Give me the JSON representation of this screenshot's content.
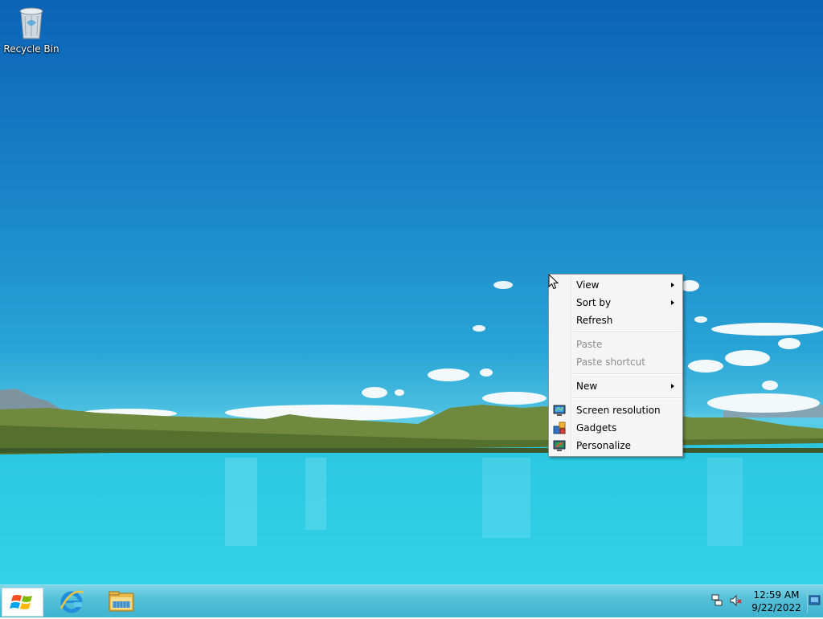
{
  "desktop": {
    "icons": [
      {
        "label": "Recycle Bin",
        "icon": "recycle-bin-icon"
      }
    ]
  },
  "context_menu": {
    "items": [
      {
        "label": "View",
        "submenu": true,
        "enabled": true
      },
      {
        "label": "Sort by",
        "submenu": true,
        "enabled": true
      },
      {
        "label": "Refresh",
        "submenu": false,
        "enabled": true
      },
      {
        "label": "Paste",
        "submenu": false,
        "enabled": false
      },
      {
        "label": "Paste shortcut",
        "submenu": false,
        "enabled": false
      },
      {
        "label": "New",
        "submenu": true,
        "enabled": true
      },
      {
        "label": "Screen resolution",
        "icon": "screen-resolution-icon",
        "enabled": true
      },
      {
        "label": "Gadgets",
        "icon": "gadgets-icon",
        "enabled": true
      },
      {
        "label": "Personalize",
        "icon": "personalize-icon",
        "enabled": true
      }
    ]
  },
  "taskbar": {
    "start_icon": "windows-logo-icon",
    "pinned": [
      "internet-explorer-icon",
      "file-explorer-icon"
    ],
    "tray": [
      "network-icon",
      "volume-muted-icon"
    ],
    "clock": {
      "time": "12:59 AM",
      "date": "9/22/2022"
    }
  },
  "colors": {
    "sky_top": "#0c63b8",
    "lake": "#33d2e8",
    "taskbar": "#56c1d9",
    "menu_bg": "#f5f5f5",
    "disabled_text": "#8d8d8d"
  }
}
